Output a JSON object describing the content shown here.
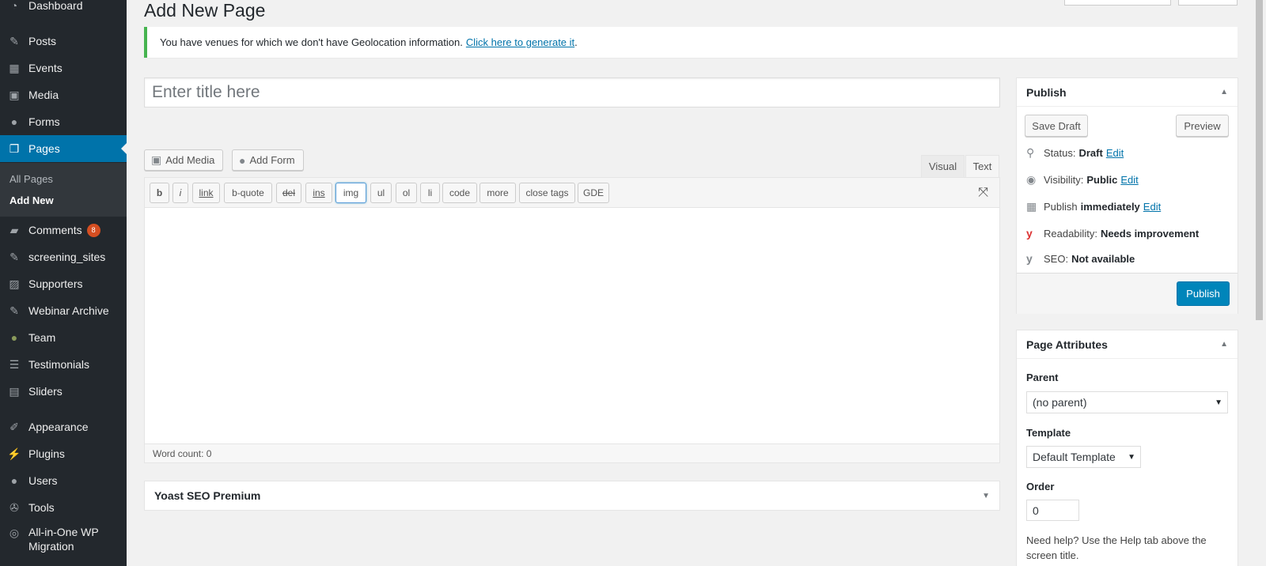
{
  "sidebar": {
    "items": [
      {
        "label": "Dashboard",
        "icon": "dashboard-icon"
      },
      {
        "label": "Posts",
        "icon": "pushpin-icon"
      },
      {
        "label": "Events",
        "icon": "calendar-icon"
      },
      {
        "label": "Media",
        "icon": "media-icon"
      },
      {
        "label": "Forms",
        "icon": "forms-icon"
      },
      {
        "label": "Pages",
        "icon": "pages-icon"
      },
      {
        "label": "Comments",
        "icon": "comment-icon",
        "badge": "8"
      },
      {
        "label": "screening_sites",
        "icon": "pushpin-icon"
      },
      {
        "label": "Supporters",
        "icon": "image-icon"
      },
      {
        "label": "Webinar Archive",
        "icon": "pushpin-icon"
      },
      {
        "label": "Team",
        "icon": "person-icon"
      },
      {
        "label": "Testimonials",
        "icon": "quote-icon"
      },
      {
        "label": "Sliders",
        "icon": "slides-icon"
      },
      {
        "label": "Appearance",
        "icon": "brush-icon"
      },
      {
        "label": "Plugins",
        "icon": "plug-icon"
      },
      {
        "label": "Users",
        "icon": "user-icon"
      },
      {
        "label": "Tools",
        "icon": "wrench-icon"
      },
      {
        "label": "All-in-One WP Migration",
        "icon": "migration-icon"
      }
    ],
    "submenu": {
      "all_pages": "All Pages",
      "add_new": "Add New"
    }
  },
  "header": {
    "title": "Add New Page"
  },
  "notice": {
    "text": "You have venues for which we don't have Geolocation information.",
    "link": "Click here to generate it",
    "tail": "."
  },
  "editor": {
    "title_placeholder": "Enter title here",
    "add_media": "Add Media",
    "add_form": "Add Form",
    "tab_visual": "Visual",
    "tab_text": "Text",
    "quicktags": [
      "b",
      "i",
      "link",
      "b-quote",
      "del",
      "ins",
      "img",
      "ul",
      "ol",
      "li",
      "code",
      "more",
      "close tags",
      "GDE"
    ],
    "word_count": "Word count: 0"
  },
  "yoast": {
    "title": "Yoast SEO Premium"
  },
  "publish": {
    "title": "Publish",
    "save_draft": "Save Draft",
    "preview": "Preview",
    "status_label": "Status:",
    "status_value": "Draft",
    "edit": "Edit",
    "visibility_label": "Visibility:",
    "visibility_value": "Public",
    "publish_label": "Publish",
    "publish_value": "immediately",
    "readability_label": "Readability:",
    "readability_value": "Needs improvement",
    "seo_label": "SEO:",
    "seo_value": "Not available",
    "publish_button": "Publish"
  },
  "attributes": {
    "title": "Page Attributes",
    "parent_label": "Parent",
    "parent_value": "(no parent)",
    "template_label": "Template",
    "template_value": "Default Template",
    "order_label": "Order",
    "order_value": "0",
    "help": "Need help? Use the Help tab above the screen title."
  }
}
